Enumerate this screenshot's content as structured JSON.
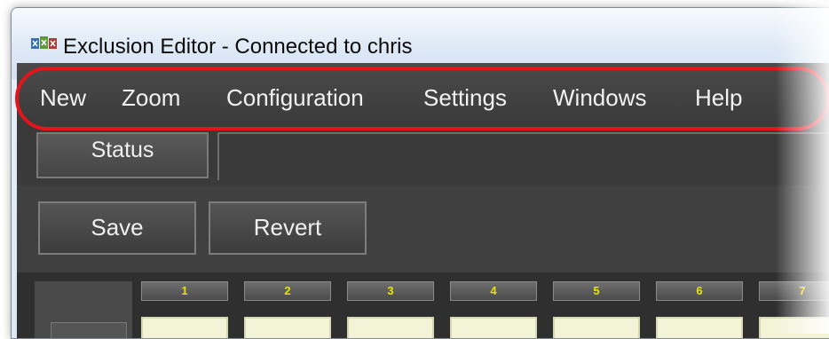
{
  "window": {
    "title": "Exclusion Editor - Connected to chris",
    "icon": "app-icon"
  },
  "menu": {
    "items": [
      {
        "label": "New"
      },
      {
        "label": "Zoom"
      },
      {
        "label": "Configuration"
      },
      {
        "label": "Settings"
      },
      {
        "label": "Windows"
      },
      {
        "label": "Help"
      }
    ]
  },
  "tabs": [
    {
      "label": "Status"
    }
  ],
  "toolbar": {
    "save_label": "Save",
    "revert_label": "Revert"
  },
  "grid": {
    "column_headers": [
      "1",
      "2",
      "3",
      "4",
      "5",
      "6",
      "7"
    ]
  },
  "colors": {
    "highlight": "#e4141c",
    "header_text": "#e8e400",
    "cell_fill": "#f3f3d8"
  }
}
